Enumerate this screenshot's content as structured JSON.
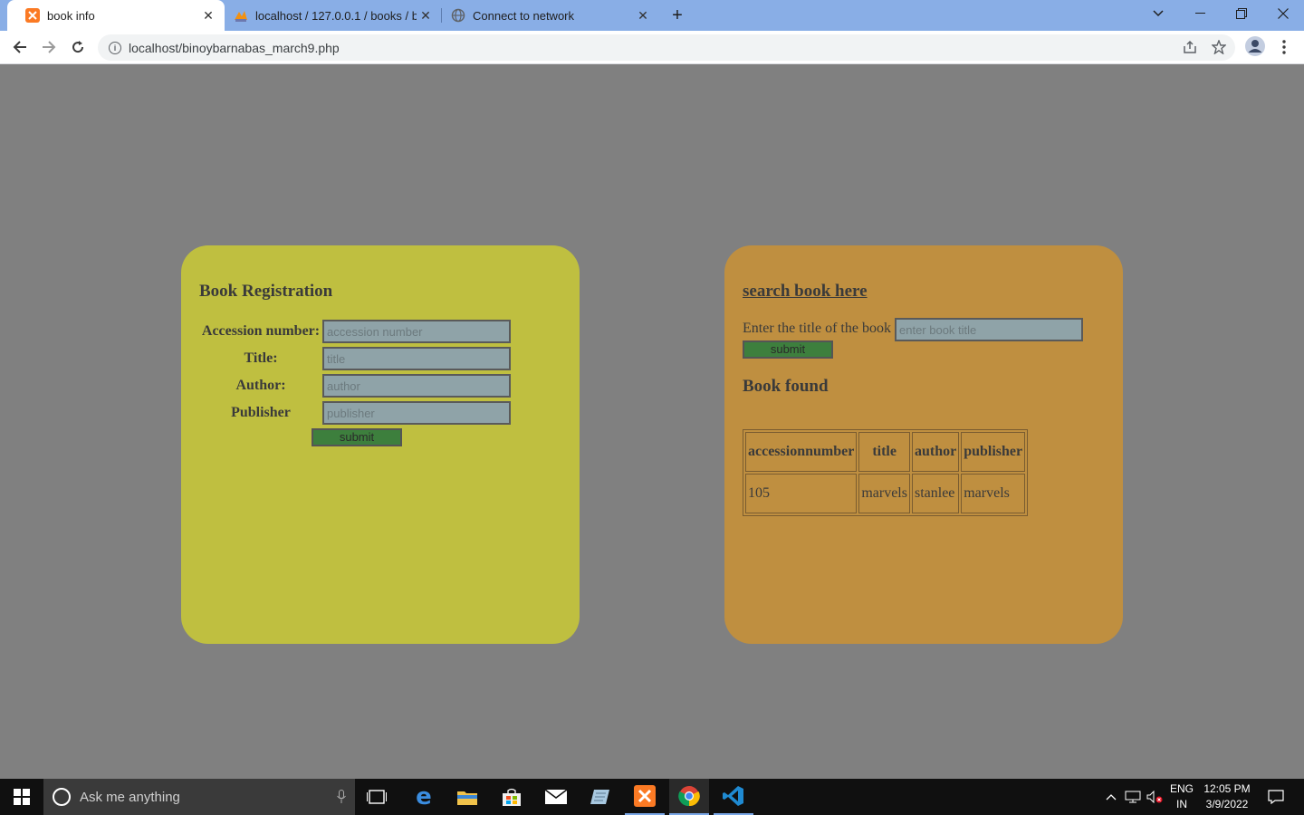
{
  "browser": {
    "tabs": [
      {
        "title": "book info",
        "active": true
      },
      {
        "title": "localhost / 127.0.0.1 / books / bo",
        "active": false
      },
      {
        "title": "Connect to network",
        "active": false
      }
    ],
    "url": "localhost/binoybarnabas_march9.php"
  },
  "registration": {
    "heading": "Book Registration",
    "fields": [
      {
        "label": "Accession number:",
        "placeholder": "accession number"
      },
      {
        "label": "Title:",
        "placeholder": "title"
      },
      {
        "label": "Author:",
        "placeholder": "author"
      },
      {
        "label": "Publisher",
        "placeholder": "publisher"
      }
    ],
    "submit_label": "submit"
  },
  "search": {
    "heading": "search book here",
    "label": "Enter the title of the book",
    "placeholder": "enter book title",
    "submit_label": "submit",
    "result_heading": "Book found",
    "columns": [
      "accessionnumber",
      "title",
      "author",
      "publisher"
    ],
    "rows": [
      [
        "105",
        "marvels",
        "stanlee",
        "marvels"
      ]
    ]
  },
  "colors": {
    "page_bg": "#808080",
    "registration_card": "#bfbf40",
    "search_card": "#bf8f40",
    "input_bg": "#8fa3a8",
    "submit_bg": "#3d7f3d"
  },
  "taskbar": {
    "search_placeholder": "Ask me anything",
    "lang_line1": "ENG",
    "lang_line2": "IN",
    "time": "12:05 PM",
    "date": "3/9/2022"
  }
}
